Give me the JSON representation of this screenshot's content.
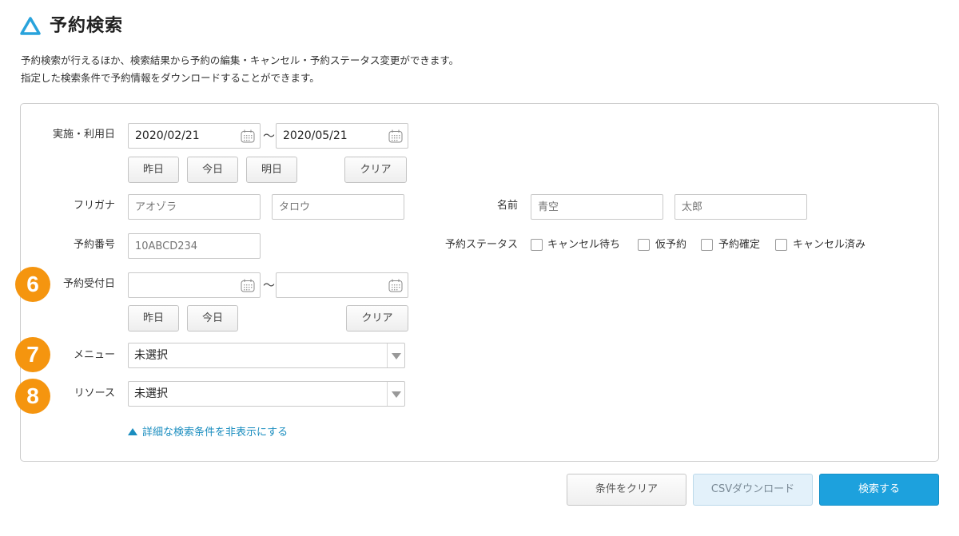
{
  "header": {
    "title": "予約検索",
    "description": [
      "予約検索が行えるほか、検索結果から予約の編集・キャンセル・予約ステータス変更ができます。",
      "指定した検索条件で予約情報をダウンロードすることができます。"
    ]
  },
  "form": {
    "usage_date": {
      "label": "実施・利用日",
      "from": "2020/02/21",
      "to": "2020/05/21",
      "separator": "〜",
      "buttons": {
        "yesterday": "昨日",
        "today": "今日",
        "tomorrow": "明日",
        "clear": "クリア"
      }
    },
    "furigana": {
      "label": "フリガナ",
      "last_placeholder": "アオゾラ",
      "first_placeholder": "タロウ"
    },
    "name": {
      "label": "名前",
      "last_placeholder": "青空",
      "first_placeholder": "太郎"
    },
    "reservation_number": {
      "label": "予約番号",
      "placeholder": "10ABCD234"
    },
    "reservation_status": {
      "label": "予約ステータス",
      "options": [
        "キャンセル待ち",
        "仮予約",
        "予約確定",
        "キャンセル済み"
      ]
    },
    "reception_date": {
      "label": "予約受付日",
      "from": "",
      "to": "",
      "separator": "〜",
      "buttons": {
        "yesterday": "昨日",
        "today": "今日",
        "clear": "クリア"
      }
    },
    "menu": {
      "label": "メニュー",
      "selected": "未選択"
    },
    "resource": {
      "label": "リソース",
      "selected": "未選択"
    },
    "toggle_link": "詳細な検索条件を非表示にする"
  },
  "badges": [
    "6",
    "7",
    "8"
  ],
  "footer": {
    "clear": "条件をクリア",
    "csv": "CSVダウンロード",
    "search": "検索する"
  },
  "colors": {
    "primary": "#1da1dd",
    "badge": "#f5950f",
    "link": "#1a8dbf"
  }
}
